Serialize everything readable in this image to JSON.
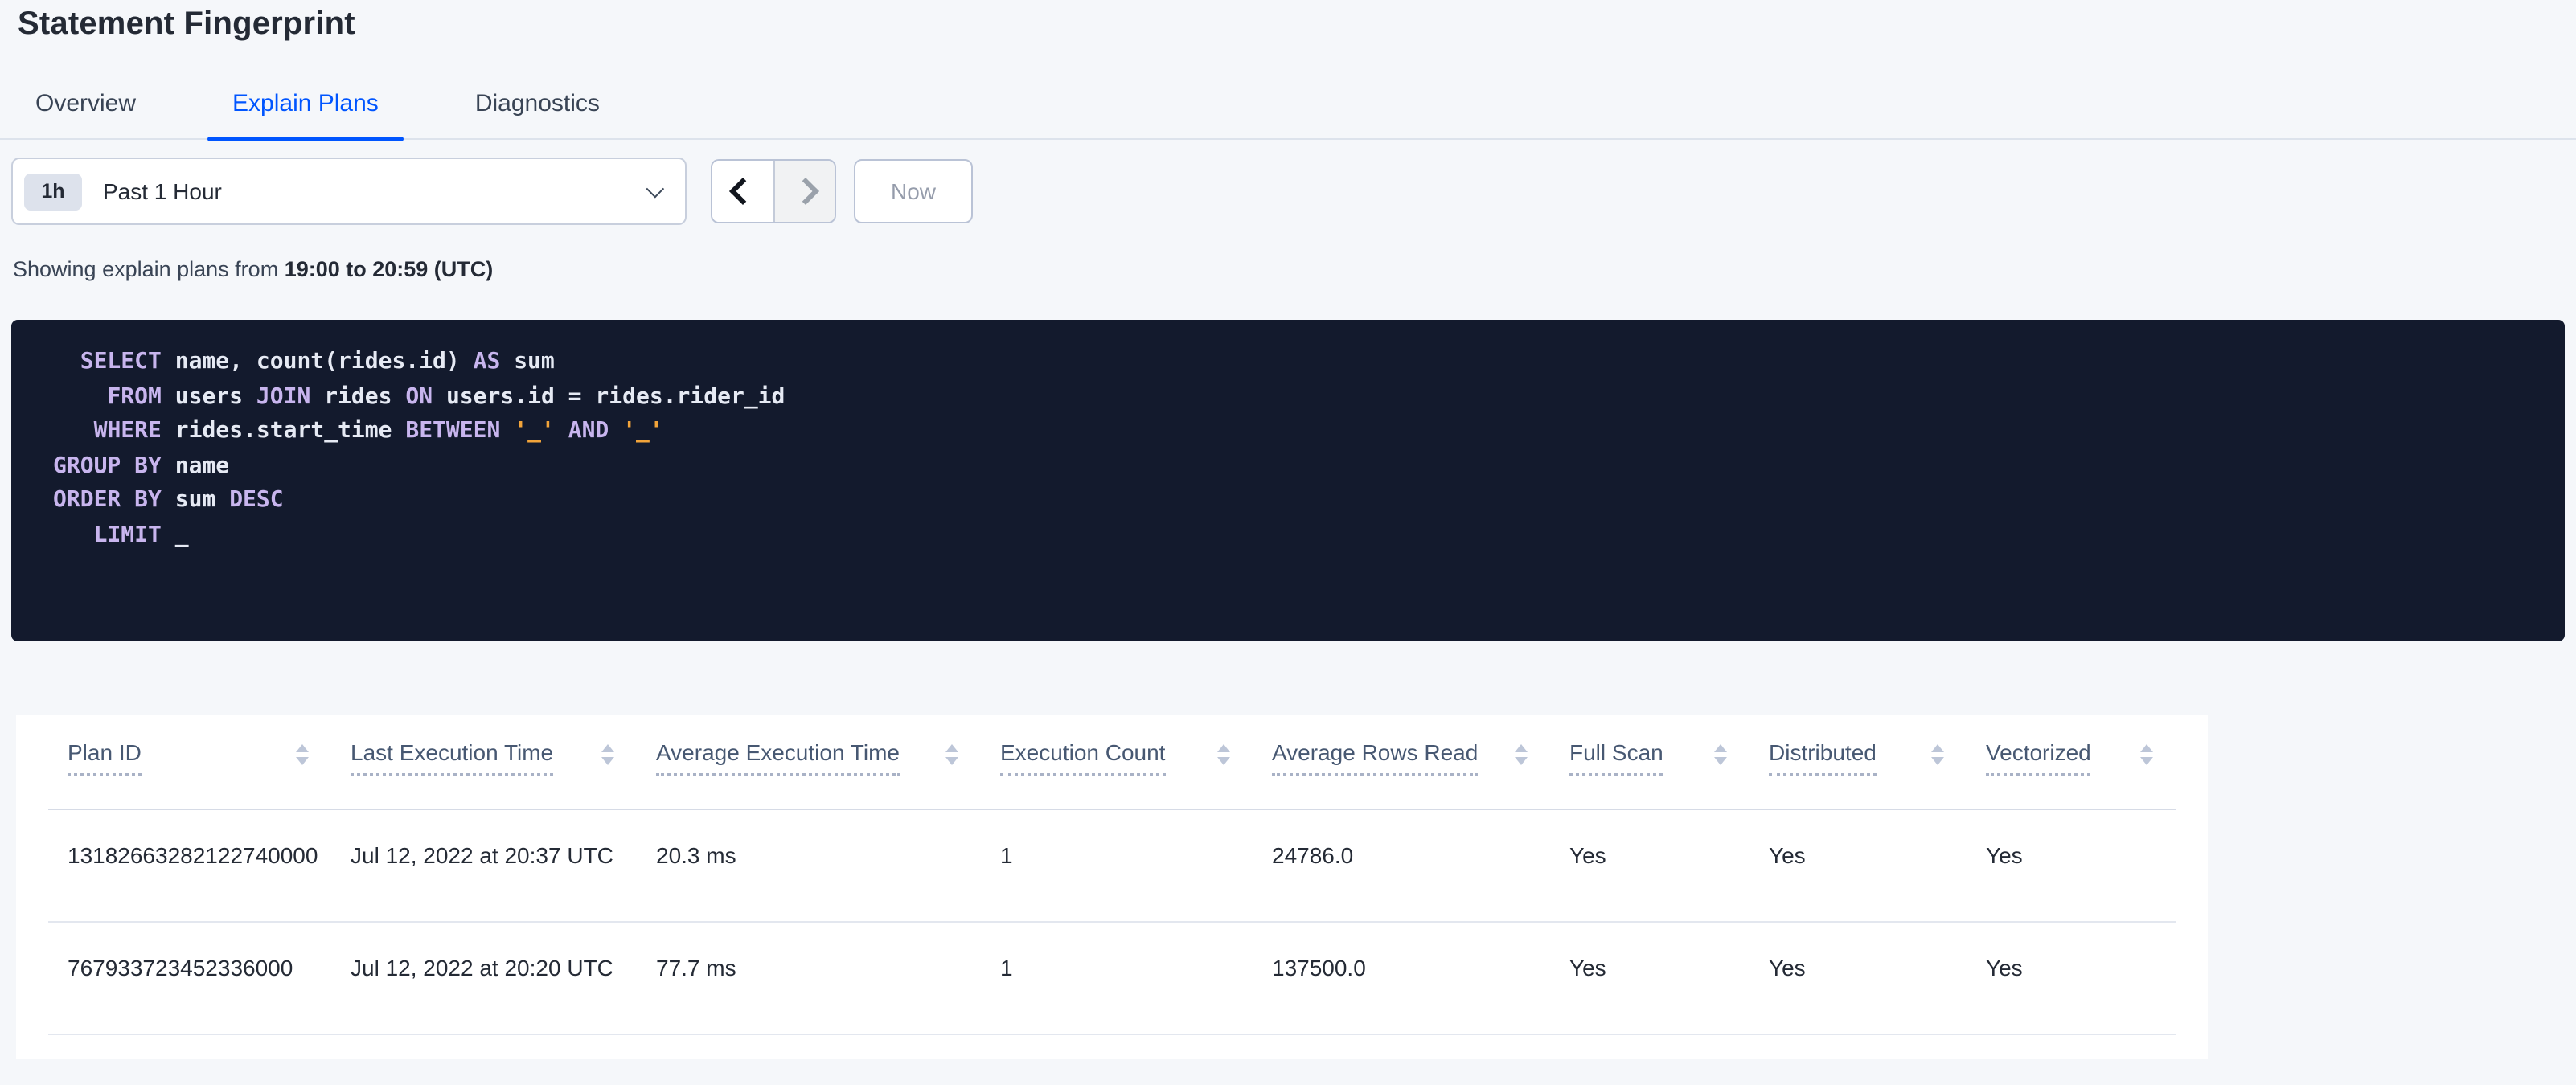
{
  "page": {
    "title": "Statement Fingerprint",
    "background": "#f5f7fa"
  },
  "tabs": {
    "items": [
      {
        "label": "Overview",
        "active": false
      },
      {
        "label": "Explain Plans",
        "active": true
      },
      {
        "label": "Diagnostics",
        "active": false
      }
    ],
    "accent_color": "#0055ff"
  },
  "time_picker": {
    "badge": "1h",
    "selected": "Past 1 Hour",
    "now_label": "Now",
    "icons": {
      "dropdown": "chevron-down-icon",
      "prev": "chevron-left-icon",
      "next": "chevron-right-icon"
    }
  },
  "subtitle": {
    "prefix": "Showing explain plans from ",
    "range": "19:00 to 20:59 (UTC)"
  },
  "sql": {
    "colors": {
      "background": "#131a2d",
      "keyword": "#c8b5ee",
      "identifier": "#e6eaf4",
      "literal": "#f2a43a"
    },
    "lines": [
      [
        [
          "pl",
          "  "
        ],
        [
          "kw",
          "SELECT"
        ],
        [
          "id",
          " name, count(rides.id) "
        ],
        [
          "kw",
          "AS"
        ],
        [
          "id",
          " sum"
        ]
      ],
      [
        [
          "pl",
          "    "
        ],
        [
          "kw",
          "FROM"
        ],
        [
          "id",
          " users "
        ],
        [
          "kw",
          "JOIN"
        ],
        [
          "id",
          " rides "
        ],
        [
          "kw",
          "ON"
        ],
        [
          "id",
          " users.id = rides.rider_id"
        ]
      ],
      [
        [
          "pl",
          "   "
        ],
        [
          "kw",
          "WHERE"
        ],
        [
          "id",
          " rides.start_time "
        ],
        [
          "kw",
          "BETWEEN"
        ],
        [
          "id",
          " "
        ],
        [
          "str",
          "'_'"
        ],
        [
          "id",
          " "
        ],
        [
          "kw",
          "AND"
        ],
        [
          "id",
          " "
        ],
        [
          "str",
          "'_'"
        ]
      ],
      [
        [
          "kw",
          "GROUP BY"
        ],
        [
          "id",
          " name"
        ]
      ],
      [
        [
          "kw",
          "ORDER BY"
        ],
        [
          "id",
          " sum "
        ],
        [
          "kw",
          "DESC"
        ]
      ],
      [
        [
          "pl",
          "   "
        ],
        [
          "kw",
          "LIMIT"
        ],
        [
          "id",
          " _"
        ]
      ]
    ]
  },
  "table": {
    "columns": [
      {
        "label": "Plan ID",
        "sortable": true
      },
      {
        "label": "Last Execution Time",
        "sortable": true
      },
      {
        "label": "Average Execution Time",
        "sortable": true
      },
      {
        "label": "Execution Count",
        "sortable": true
      },
      {
        "label": "Average Rows Read",
        "sortable": true
      },
      {
        "label": "Full Scan",
        "sortable": true
      },
      {
        "label": "Distributed",
        "sortable": true
      },
      {
        "label": "Vectorized",
        "sortable": true
      }
    ],
    "rows": [
      {
        "cells": [
          "13182663282122740000",
          "Jul 12, 2022 at 20:37 UTC",
          "20.3 ms",
          "1",
          "24786.0",
          "Yes",
          "Yes",
          "Yes"
        ]
      },
      {
        "cells": [
          "767933723452336000",
          "Jul 12, 2022 at 20:20 UTC",
          "77.7 ms",
          "1",
          "137500.0",
          "Yes",
          "Yes",
          "Yes"
        ]
      }
    ]
  }
}
